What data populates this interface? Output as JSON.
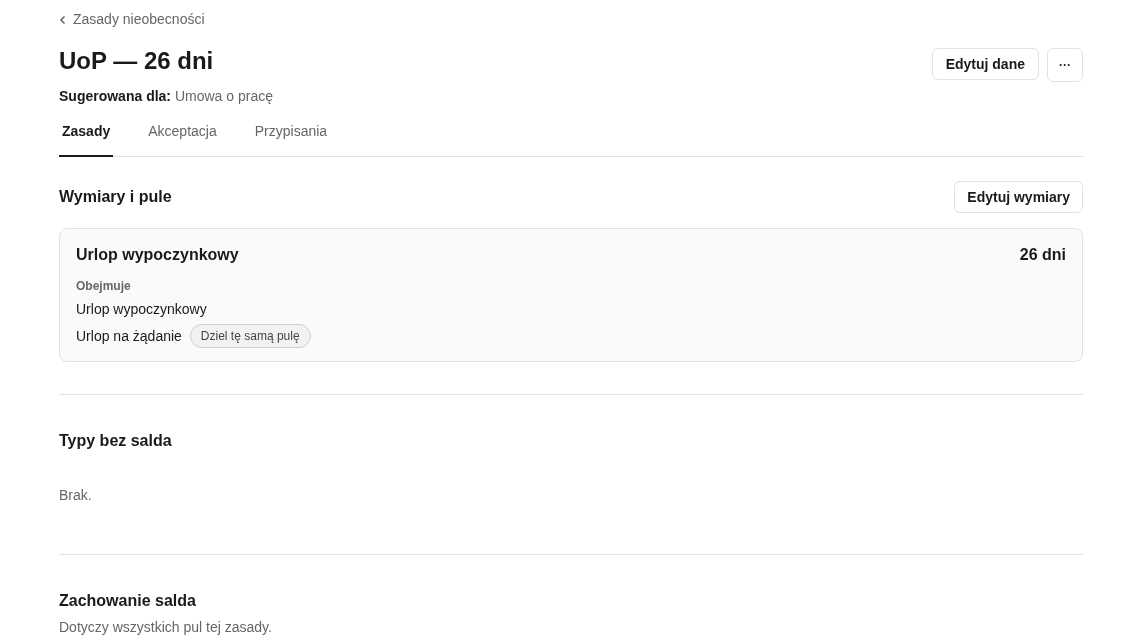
{
  "breadcrumb": {
    "label": "Zasady nieobecności"
  },
  "title": "UoP — 26 dni",
  "actions": {
    "edit": "Edytuj dane",
    "more": "···"
  },
  "suggested": {
    "label": "Sugerowana dla:",
    "value": "Umowa o pracę"
  },
  "tabs": [
    {
      "label": "Zasady",
      "selected": true
    },
    {
      "label": "Akceptacja",
      "selected": false
    },
    {
      "label": "Przypisania",
      "selected": false
    }
  ],
  "pools_section": {
    "title": "Wymiary i pule",
    "button": "Edytuj wymiary",
    "pools": [
      {
        "name": "Urlop wypoczynkowy",
        "amount": "26 dni",
        "covers_label": "Obejmuje",
        "types": [
          {
            "name": "Urlop wypoczynkowy"
          },
          {
            "name": "Urlop na żądanie",
            "badge": "Dziel tę samą pulę"
          }
        ]
      }
    ]
  },
  "no_balance_section": {
    "title": "Typy bez salda",
    "empty": "Brak."
  },
  "balance_section": {
    "title": "Zachowanie salda",
    "description": "Dotyczy wszystkich pul tej zasady."
  }
}
